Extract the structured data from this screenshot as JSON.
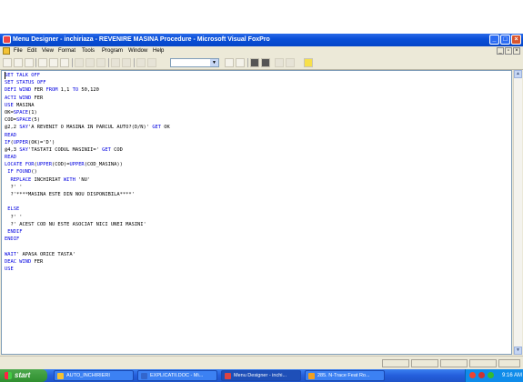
{
  "window": {
    "title": "Menu Designer - inchiriaza - REVENIRE MASINA Procedure - Microsoft Visual FoxPro",
    "controls": {
      "minimize": "_",
      "maximize": "□",
      "close": "×"
    }
  },
  "menubar": {
    "items": [
      "File",
      "Edit",
      "View",
      "Format",
      "Tools",
      "Program",
      "Window",
      "Help"
    ],
    "mdi_controls": {
      "minimize": "_",
      "restore": "▫",
      "close": "×"
    }
  },
  "toolbar": {
    "icons": [
      "new-icon",
      "open-icon",
      "save-icon",
      "print-icon",
      "print-preview-icon",
      "spell-check-icon",
      "cut-icon",
      "copy-icon",
      "paste-icon",
      "undo-icon",
      "redo-icon",
      "run-icon",
      "modify-form-icon"
    ],
    "combo_value": "",
    "right_icons": [
      "command-window-icon",
      "view-window-icon",
      "form-wizard-icon",
      "report-wizard-icon",
      "autoform-icon",
      "autoreport-icon",
      "help-icon"
    ]
  },
  "editor": {
    "lines": [
      "SET TALK OFF",
      "SET STATUS OFF",
      "DEFI WIND FER FROM 1,1 TO 50,120",
      "ACTI WIND FER",
      "USE MASINA",
      "OK=SPACE(1)",
      "COD=SPACE(5)",
      "@2,2 SAY'A REVENIT O MASINA IN PARCUL AUTO?(D/N)' GET OK",
      "READ",
      "IF(UPPER(OK)='D')",
      "@4,3 SAY'TASTATI CODUL MASINII=' GET COD",
      "READ",
      "LOCATE FOR(UPPER(COD)=UPPER(COD_MASINA))",
      " IF FOUND()",
      "  REPLACE INCHIRIAT WITH 'NU'",
      "  ?' '",
      "  ?'****MASINA ESTE DIN NOU DISPONIBILA****'",
      "",
      " ELSE",
      "  ?' '",
      "  ?' ACEST COD NU ESTE ASOCIAT NICI UNEI MASINI'",
      " ENDIF",
      "ENDIF",
      "",
      "WAIT' APASA ORICE TASTA'",
      "DEAC WIND FER",
      "USE"
    ]
  },
  "colors": {
    "keyword": "#0000e0",
    "plain": "#000000",
    "titlebar": "#0a4fd8",
    "taskbar": "#245edb"
  },
  "taskbar": {
    "start_label": "start",
    "tasks": [
      {
        "label": "AUTO_INCHIRIERI",
        "icon_color": "#f4c234",
        "active": false
      },
      {
        "label": "EXPLICATII.DOC - Mi...",
        "icon_color": "#3366cc",
        "active": false
      },
      {
        "label": "Menu Designer - inchi...",
        "icon_color": "#d44",
        "active": true
      },
      {
        "label": "285. N-Trace Feat Ro...",
        "icon_color": "#f0a020",
        "active": false
      }
    ],
    "clock": "9:16 AM"
  }
}
